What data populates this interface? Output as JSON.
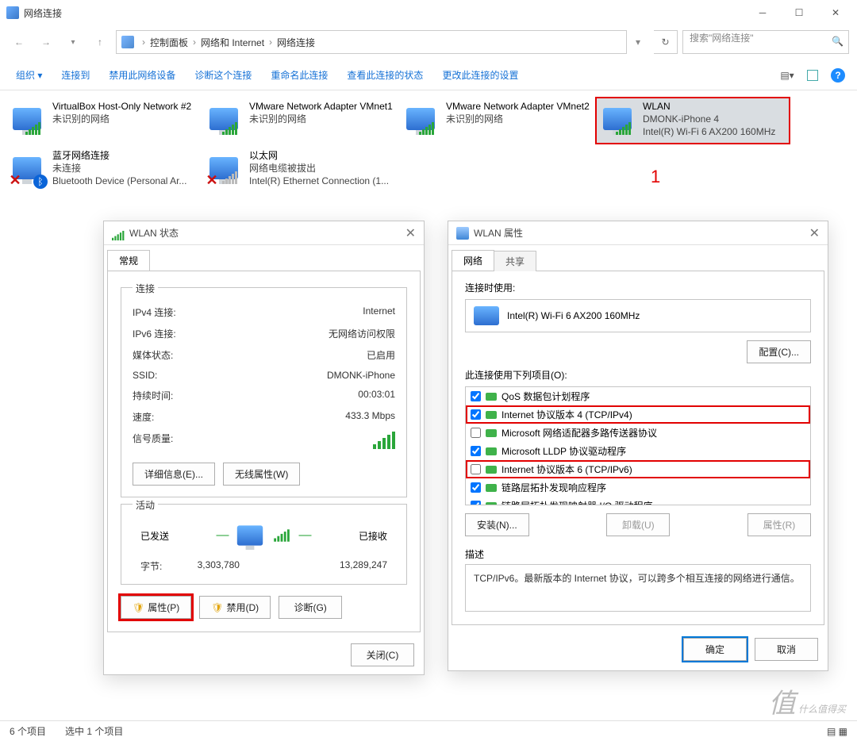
{
  "window": {
    "title": "网络连接"
  },
  "breadcrumb": {
    "p1": "控制面板",
    "p2": "网络和 Internet",
    "p3": "网络连接"
  },
  "search": {
    "placeholder": "搜索\"网络连接\""
  },
  "cmdbar": {
    "organize": "组织 ▾",
    "connect_to": "连接到",
    "disable": "禁用此网络设备",
    "diagnose": "诊断这个连接",
    "rename": "重命名此连接",
    "view_status": "查看此连接的状态",
    "change_settings": "更改此连接的设置"
  },
  "items": [
    {
      "name": "VirtualBox Host-Only Network #2",
      "l2": "未识别的网络",
      "l3": ""
    },
    {
      "name": "VMware Network Adapter VMnet1",
      "l2": "未识别的网络",
      "l3": ""
    },
    {
      "name": "VMware Network Adapter VMnet2",
      "l2": "未识别的网络",
      "l3": ""
    },
    {
      "name": "WLAN",
      "l2": "DMONK-iPhone 4",
      "l3": "Intel(R) Wi-Fi 6 AX200 160MHz"
    },
    {
      "name": "蓝牙网络连接",
      "l2": "未连接",
      "l3": "Bluetooth Device (Personal Ar..."
    },
    {
      "name": "以太网",
      "l2": "网络电缆被拔出",
      "l3": "Intel(R) Ethernet Connection (1..."
    }
  ],
  "annot": {
    "one": "1"
  },
  "status_dlg": {
    "title": "WLAN 状态",
    "tab_general": "常规",
    "sec_conn": "连接",
    "ipv4_k": "IPv4 连接:",
    "ipv4_v": "Internet",
    "ipv6_k": "IPv6 连接:",
    "ipv6_v": "无网络访问权限",
    "media_k": "媒体状态:",
    "media_v": "已启用",
    "ssid_k": "SSID:",
    "ssid_v": "DMONK-iPhone",
    "dur_k": "持续时间:",
    "dur_v": "00:03:01",
    "spd_k": "速度:",
    "spd_v": "433.3 Mbps",
    "sig_k": "信号质量:",
    "btn_detail": "详细信息(E)...",
    "btn_wifi": "无线属性(W)",
    "sec_act": "活动",
    "sent": "已发送",
    "recv": "已接收",
    "bytes_k": "字节:",
    "bytes_sent": "3,303,780",
    "bytes_recv": "13,289,247",
    "btn_prop": "属性(P)",
    "btn_dis": "禁用(D)",
    "btn_diag": "诊断(G)",
    "btn_close": "关闭(C)"
  },
  "prop_dlg": {
    "title": "WLAN 属性",
    "tab_net": "网络",
    "tab_share": "共享",
    "connect_using": "连接时使用:",
    "adapter": "Intel(R) Wi-Fi 6 AX200 160MHz",
    "btn_cfg": "配置(C)...",
    "items_label": "此连接使用下列项目(O):",
    "chk": [
      {
        "c": true,
        "t": "QoS 数据包计划程序"
      },
      {
        "c": true,
        "t": "Internet 协议版本 4 (TCP/IPv4)"
      },
      {
        "c": false,
        "t": "Microsoft 网络适配器多路传送器协议"
      },
      {
        "c": true,
        "t": "Microsoft LLDP 协议驱动程序"
      },
      {
        "c": false,
        "t": "Internet 协议版本 6 (TCP/IPv6)"
      },
      {
        "c": true,
        "t": "链路层拓扑发现响应程序"
      },
      {
        "c": true,
        "t": "链路层拓扑发现映射器 I/O 驱动程序"
      }
    ],
    "btn_install": "安装(N)...",
    "btn_uninstall": "卸载(U)",
    "btn_itemprop": "属性(R)",
    "desc_label": "描述",
    "desc_body": "TCP/IPv6。最新版本的 Internet 协议，可以跨多个相互连接的网络进行通信。",
    "btn_ok": "确定",
    "btn_cancel": "取消"
  },
  "statusbar": {
    "count": "6 个项目",
    "selected": "选中 1 个项目"
  },
  "watermark": {
    "txt1": "什么值得买"
  }
}
